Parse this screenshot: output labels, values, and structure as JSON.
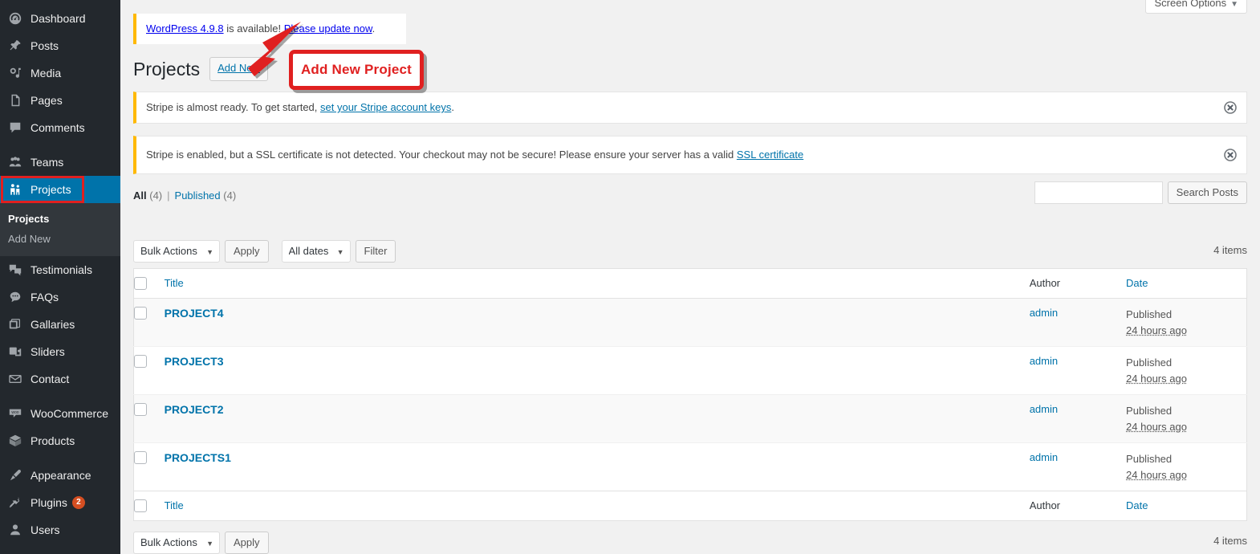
{
  "sidebar": {
    "items": [
      {
        "label": "Dashboard",
        "icon": "dashboard-icon",
        "name": "dashboard"
      },
      {
        "label": "Posts",
        "icon": "pin-icon",
        "name": "posts"
      },
      {
        "label": "Media",
        "icon": "media-icon",
        "name": "media"
      },
      {
        "label": "Pages",
        "icon": "page-icon",
        "name": "pages"
      },
      {
        "label": "Comments",
        "icon": "comment-icon",
        "name": "comments"
      },
      {
        "label": "Teams",
        "icon": "groups-icon",
        "name": "teams"
      },
      {
        "label": "Projects",
        "icon": "projects-icon",
        "name": "projects",
        "current": true
      },
      {
        "label": "Testimonials",
        "icon": "testimonials-icon",
        "name": "testimonials"
      },
      {
        "label": "FAQs",
        "icon": "faqs-icon",
        "name": "faqs"
      },
      {
        "label": "Gallaries",
        "icon": "gallery-icon",
        "name": "gallaries"
      },
      {
        "label": "Sliders",
        "icon": "slider-icon",
        "name": "sliders"
      },
      {
        "label": "Contact",
        "icon": "envelope-icon",
        "name": "contact"
      },
      {
        "label": "WooCommerce",
        "icon": "woocommerce-icon",
        "name": "woocommerce"
      },
      {
        "label": "Products",
        "icon": "products-box-icon",
        "name": "products"
      },
      {
        "label": "Appearance",
        "icon": "paintbrush-icon",
        "name": "appearance"
      },
      {
        "label": "Plugins",
        "icon": "plug-icon",
        "name": "plugins",
        "badge": "2"
      },
      {
        "label": "Users",
        "icon": "user-icon",
        "name": "users"
      }
    ],
    "submenu": {
      "current_label": "Projects",
      "add_new_label": "Add New"
    }
  },
  "screen_options": {
    "label": "Screen Options",
    "caret": "▼"
  },
  "update_nag": {
    "link_text": "WordPress 4.9.8",
    "middle_text": " is available! ",
    "action_text": "Please update now",
    "end_text": "."
  },
  "header": {
    "title": "Projects",
    "add_new_label": "Add New"
  },
  "annotation": {
    "callout_text": "Add New Project",
    "color": "#e02020"
  },
  "notices": [
    {
      "name": "stripe-keys-notice",
      "text_before": "Stripe is almost ready. To get started, ",
      "link_text": "set your Stripe account keys",
      "text_after": ".",
      "dismiss_icon": "dismiss-circle-x-icon"
    },
    {
      "name": "stripe-ssl-notice",
      "text_before": "Stripe is enabled, but a SSL certificate is not detected. Your checkout may not be secure! Please ensure your server has a valid ",
      "link_text": "SSL certificate",
      "text_after": "",
      "dismiss_icon": "dismiss-circle-x-icon"
    }
  ],
  "views": {
    "all_label": "All",
    "all_count": "(4)",
    "separator": "|",
    "published_label": "Published",
    "published_count": "(4)"
  },
  "search": {
    "value": "",
    "placeholder": "",
    "button_label": "Search Posts"
  },
  "tablenav_top": {
    "bulk_actions_label": "Bulk Actions",
    "bulk_caret": "▼",
    "apply_label": "Apply",
    "dates_label": "All dates",
    "dates_caret": "▼",
    "filter_label": "Filter",
    "displaying_num": "4 items"
  },
  "tablenav_bottom": {
    "bulk_actions_label": "Bulk Actions",
    "bulk_caret": "▼",
    "apply_label": "Apply",
    "displaying_num": "4 items"
  },
  "table": {
    "columns": {
      "title": "Title",
      "author": "Author",
      "date": "Date"
    },
    "rows": [
      {
        "title": "PROJECT4",
        "author": "admin",
        "status": "Published",
        "relative_date": "24 hours ago"
      },
      {
        "title": "PROJECT3",
        "author": "admin",
        "status": "Published",
        "relative_date": "24 hours ago"
      },
      {
        "title": "PROJECT2",
        "author": "admin",
        "status": "Published",
        "relative_date": "24 hours ago"
      },
      {
        "title": "PROJECTS1",
        "author": "admin",
        "status": "Published",
        "relative_date": "24 hours ago"
      }
    ]
  },
  "colors": {
    "accent_blue": "#0073aa",
    "sidebar_bg": "#23282d",
    "submenu_bg": "#32373c",
    "notice_border": "#ffb900",
    "annotation_red": "#e02020",
    "badge_orange": "#d54e21"
  }
}
